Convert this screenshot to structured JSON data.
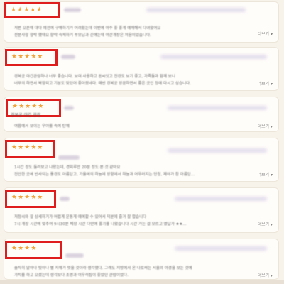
{
  "reviews": [
    {
      "stars": "★★★★★",
      "title": "",
      "lines": [
        "저번 오픈때 대다 예전에 구매하기가 어려웠는데 이번에 아주 좋 좋게 예매해서 다녀왔어요",
        "전분사항 향락 했데요 향락 숙제하기 부모님과 긴얘는데 야간개장은 처음이었습니다."
      ],
      "more": "더보기 ▾"
    },
    {
      "stars": "★★★★★",
      "title": "",
      "lines": [
        "경복궁 야간관람하나 너무 좋습니다. 보여 사용하고 돈씨잇고 전경도 보기 좋고, 가족들과 함께 보니",
        "너무의 하면서 북항되고 기분도 맞았어 좋아졌네다. 매번 경복궁 방문하면서 좋은 곳인 정에 다시고 싶습니다."
      ],
      "more": "더보기 ▾"
    },
    {
      "stars": "★★★★★",
      "title": "경복궁 야간 관람",
      "lines": [
        "여름에서 보이는 우아를 속에 탄체"
      ],
      "more": "더보기 ▾"
    },
    {
      "stars": "★★★★★",
      "title": "",
      "lines": [
        "1시간 정도 둘러보고 나왔는데, 경회루만 20분 정도 본 것 같아요",
        "전안한 곳에 반사되는 풍경도 아름답고, 가을에의 하늘에 방향에서 하늘과 어우러지는 단청, 제야가 참 아름답..."
      ],
      "more": "더보기 ▾"
    },
    {
      "stars": "★★★★★",
      "title": "",
      "lines": [
        "저정씨와 잘 상세하기가 어렵게 운동게 예예할 수 있어서 덕분에 즐거 잘 합습니다",
        "7시 개장 시간에 맞추어 9시30분 폐장 시간 다만에 좋기를 나왔습니다 시간 가는 걸 모르고 였답가 ★★..."
      ],
      "more": "더보기 ▾"
    },
    {
      "stars": "★★★★",
      "title": "",
      "lines": [
        "솔직히 날아나 빛이나 별 자체가 멋을 것이라 생각했다. 그래도 지방에서 온 나로써는 서울의 야경을 보는 것에",
        "가치를 하고 오셨는데 생각보다 조명과 어우러짐이 좋았던 관람이었다."
      ],
      "more": "더보기 ▾"
    }
  ]
}
